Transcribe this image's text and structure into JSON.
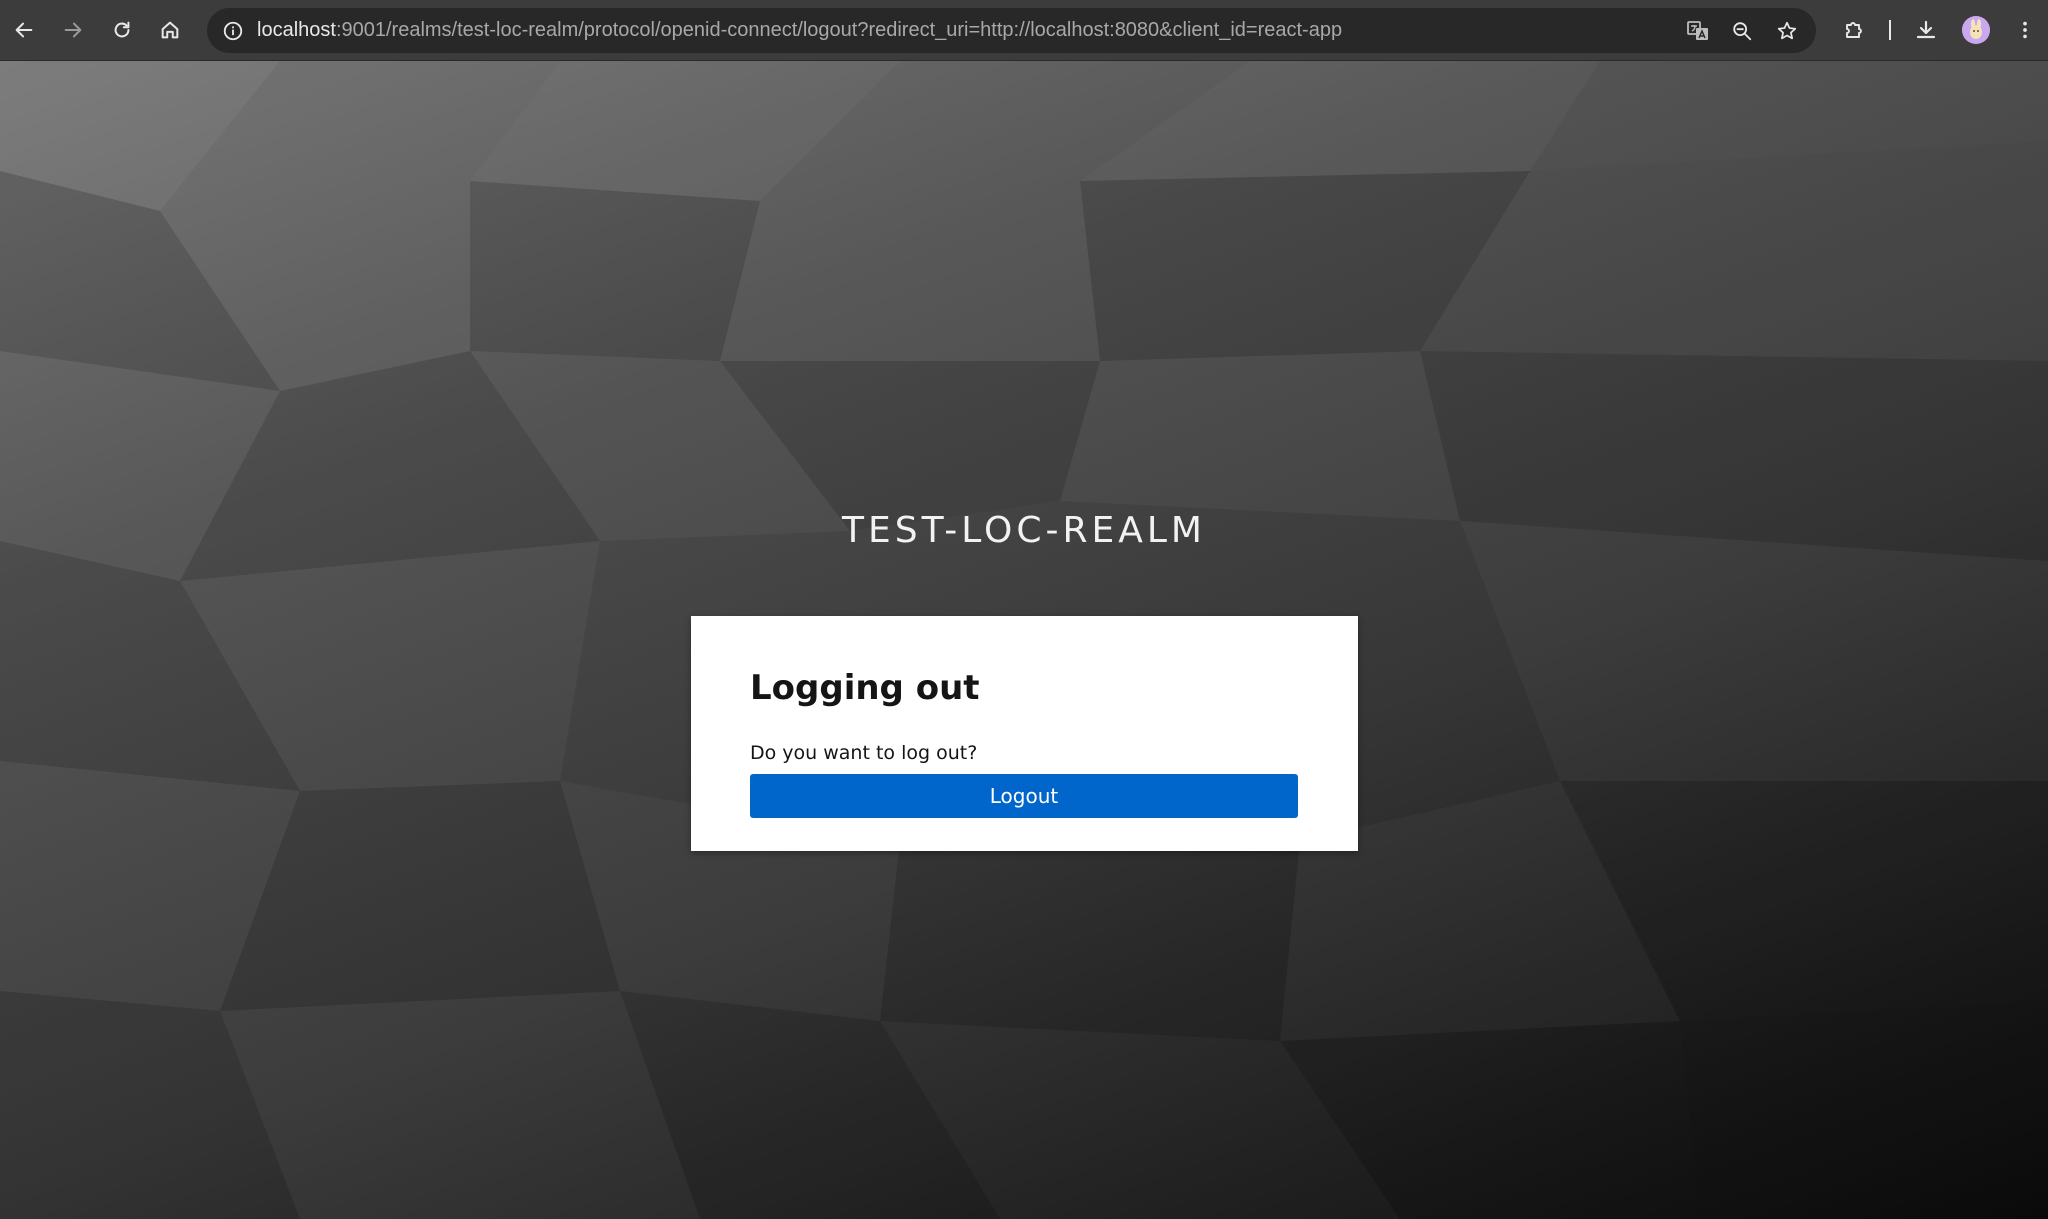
{
  "browser": {
    "url_host": "localhost",
    "url_rest": ":9001/realms/test-loc-realm/protocol/openid-connect/logout?redirect_uri=http://localhost:8080&client_id=react-app",
    "icons": {
      "back": "arrow-left-icon",
      "forward": "arrow-right-icon",
      "reload": "reload-icon",
      "home": "home-icon",
      "site_info": "info-icon",
      "translate": "translate-icon",
      "zoom": "zoom-icon",
      "bookmark": "star-icon",
      "extensions": "puzzle-icon",
      "downloads": "download-icon",
      "profile": "avatar",
      "menu": "kebab-menu-icon"
    }
  },
  "page": {
    "realm_title": "TEST-LOC-REALM",
    "card": {
      "title": "Logging out",
      "question": "Do you want to log out?",
      "logout_label": "Logout"
    }
  },
  "colors": {
    "toolbar": "#3c3c3c",
    "omnibox": "#282828",
    "button_primary": "#0066cc",
    "card": "#ffffff"
  }
}
